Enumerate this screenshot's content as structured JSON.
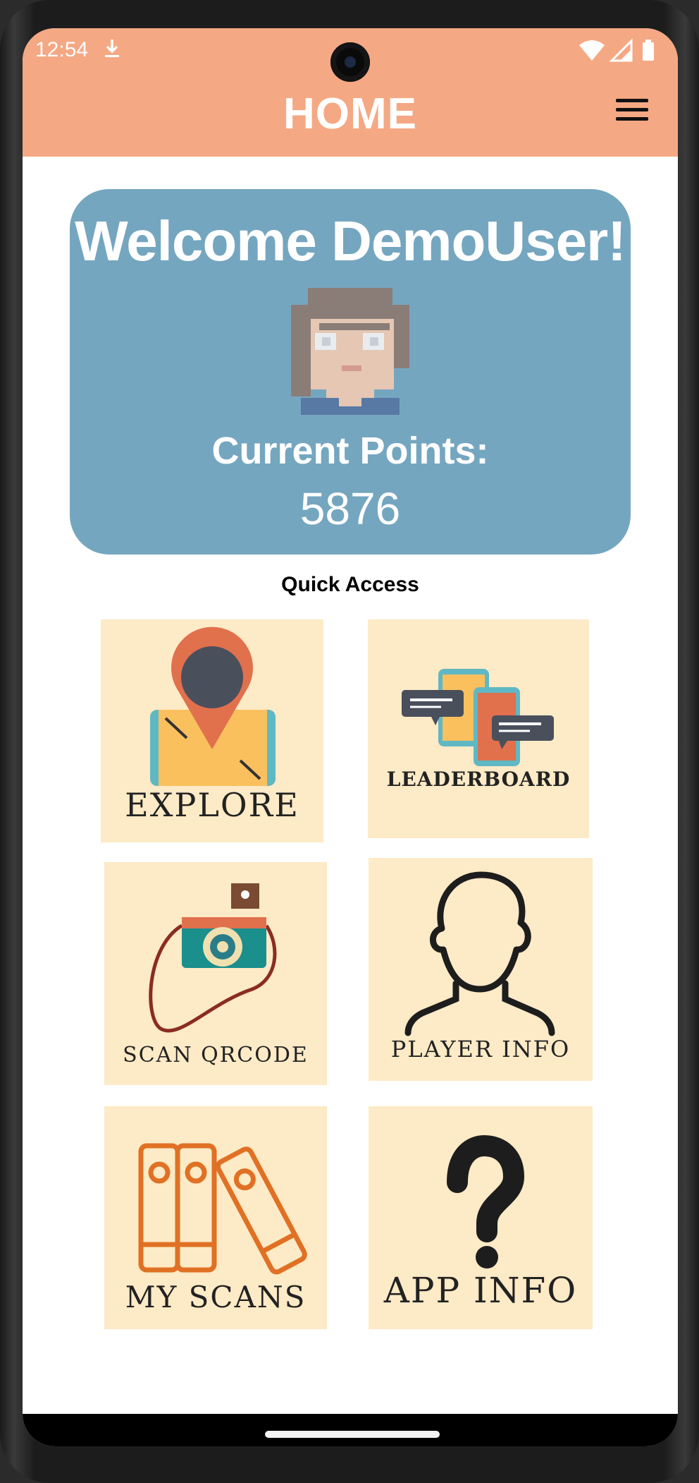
{
  "status_bar": {
    "time": "12:54"
  },
  "app_bar": {
    "title": "HOME"
  },
  "welcome": {
    "greeting": "Welcome DemoUser!",
    "points_label": "Current Points:",
    "points_value": "5876"
  },
  "quick_access": {
    "heading": "Quick Access",
    "tiles": [
      {
        "label": "EXPLORE",
        "icon": "map-pin-phone-icon"
      },
      {
        "label": "LEADERBOARD",
        "icon": "chat-phones-icon"
      },
      {
        "label": "SCAN QRCODE",
        "icon": "camera-icon"
      },
      {
        "label": "PLAYER INFO",
        "icon": "person-icon"
      },
      {
        "label": "MY SCANS",
        "icon": "binders-icon"
      },
      {
        "label": "APP INFO",
        "icon": "question-mark-icon"
      }
    ]
  },
  "colors": {
    "app_bar": "#f5a884",
    "welcome_card": "#75a6c0",
    "tile_background": "#fdeac6"
  }
}
